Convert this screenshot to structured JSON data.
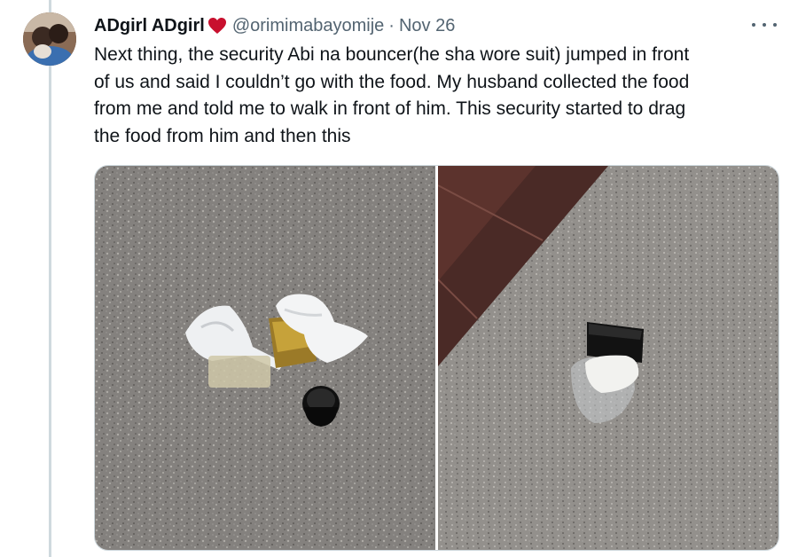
{
  "tweet": {
    "author": {
      "display_name": "ADgirl ADgirl",
      "name_emoji": "heart",
      "handle": "@orimimabayomije"
    },
    "separator": "·",
    "date": "Nov 26",
    "text_lines": [
      "Next thing, the security Abi na bouncer(he sha wore suit) jumped in front",
      "of us and said I couldn’t go with the food. My husband collected the food",
      "from me and told me to walk in front of him. This security started to drag",
      "the food from him and then this"
    ],
    "media": [
      "photo-food-on-floor",
      "photo-containers-on-floor"
    ]
  },
  "colors": {
    "text": "#0f1419",
    "secondary_text": "#536471",
    "border": "#cfd9de",
    "heart": "#c8102e"
  }
}
